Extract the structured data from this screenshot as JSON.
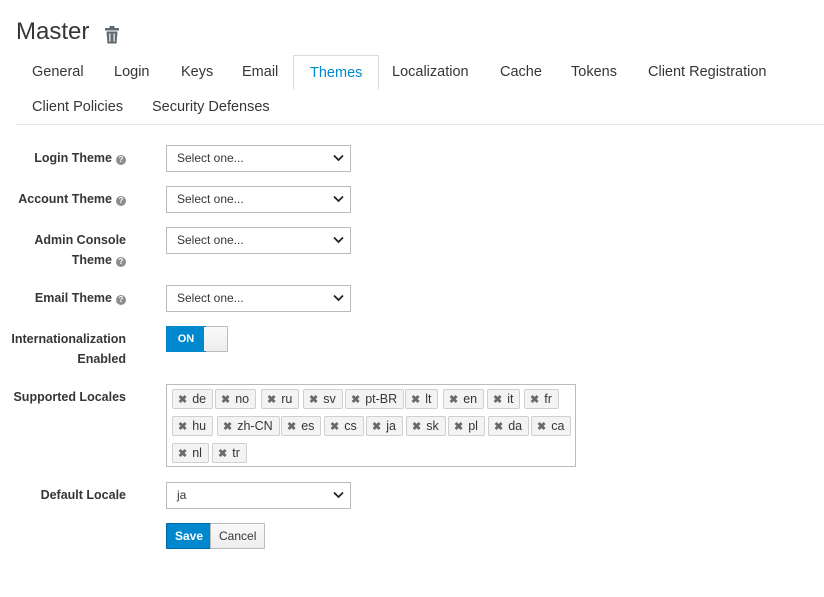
{
  "header": {
    "title": "Master"
  },
  "tabs": [
    {
      "label": "General"
    },
    {
      "label": "Login"
    },
    {
      "label": "Keys"
    },
    {
      "label": "Email"
    },
    {
      "label": "Themes",
      "active": true
    },
    {
      "label": "Localization"
    },
    {
      "label": "Cache"
    },
    {
      "label": "Tokens"
    },
    {
      "label": "Client Registration"
    },
    {
      "label": "Client Policies"
    },
    {
      "label": "Security Defenses"
    }
  ],
  "form": {
    "login_theme": {
      "label": "Login Theme",
      "value": "Select one..."
    },
    "account_theme": {
      "label": "Account Theme",
      "value": "Select one..."
    },
    "admin_console_theme": {
      "label_line1": "Admin Console",
      "label_line2": "Theme",
      "value": "Select one..."
    },
    "email_theme": {
      "label": "Email Theme",
      "value": "Select one..."
    },
    "internationalization": {
      "label_line1": "Internationalization",
      "label_line2": "Enabled",
      "state": "ON"
    },
    "supported_locales": {
      "label": "Supported Locales",
      "items": [
        "de",
        "no",
        "ru",
        "sv",
        "pt-BR",
        "lt",
        "en",
        "it",
        "fr",
        "hu",
        "zh-CN",
        "es",
        "cs",
        "ja",
        "sk",
        "pl",
        "da",
        "ca",
        "nl",
        "tr"
      ]
    },
    "default_locale": {
      "label": "Default Locale",
      "value": "ja"
    }
  },
  "buttons": {
    "save": "Save",
    "cancel": "Cancel"
  },
  "icons": {
    "trash": "trash-icon",
    "help": "help-icon",
    "chevron": "chevron-down-icon",
    "remove": "remove-icon"
  },
  "colors": {
    "accent": "#0088ce",
    "text": "#363636"
  }
}
